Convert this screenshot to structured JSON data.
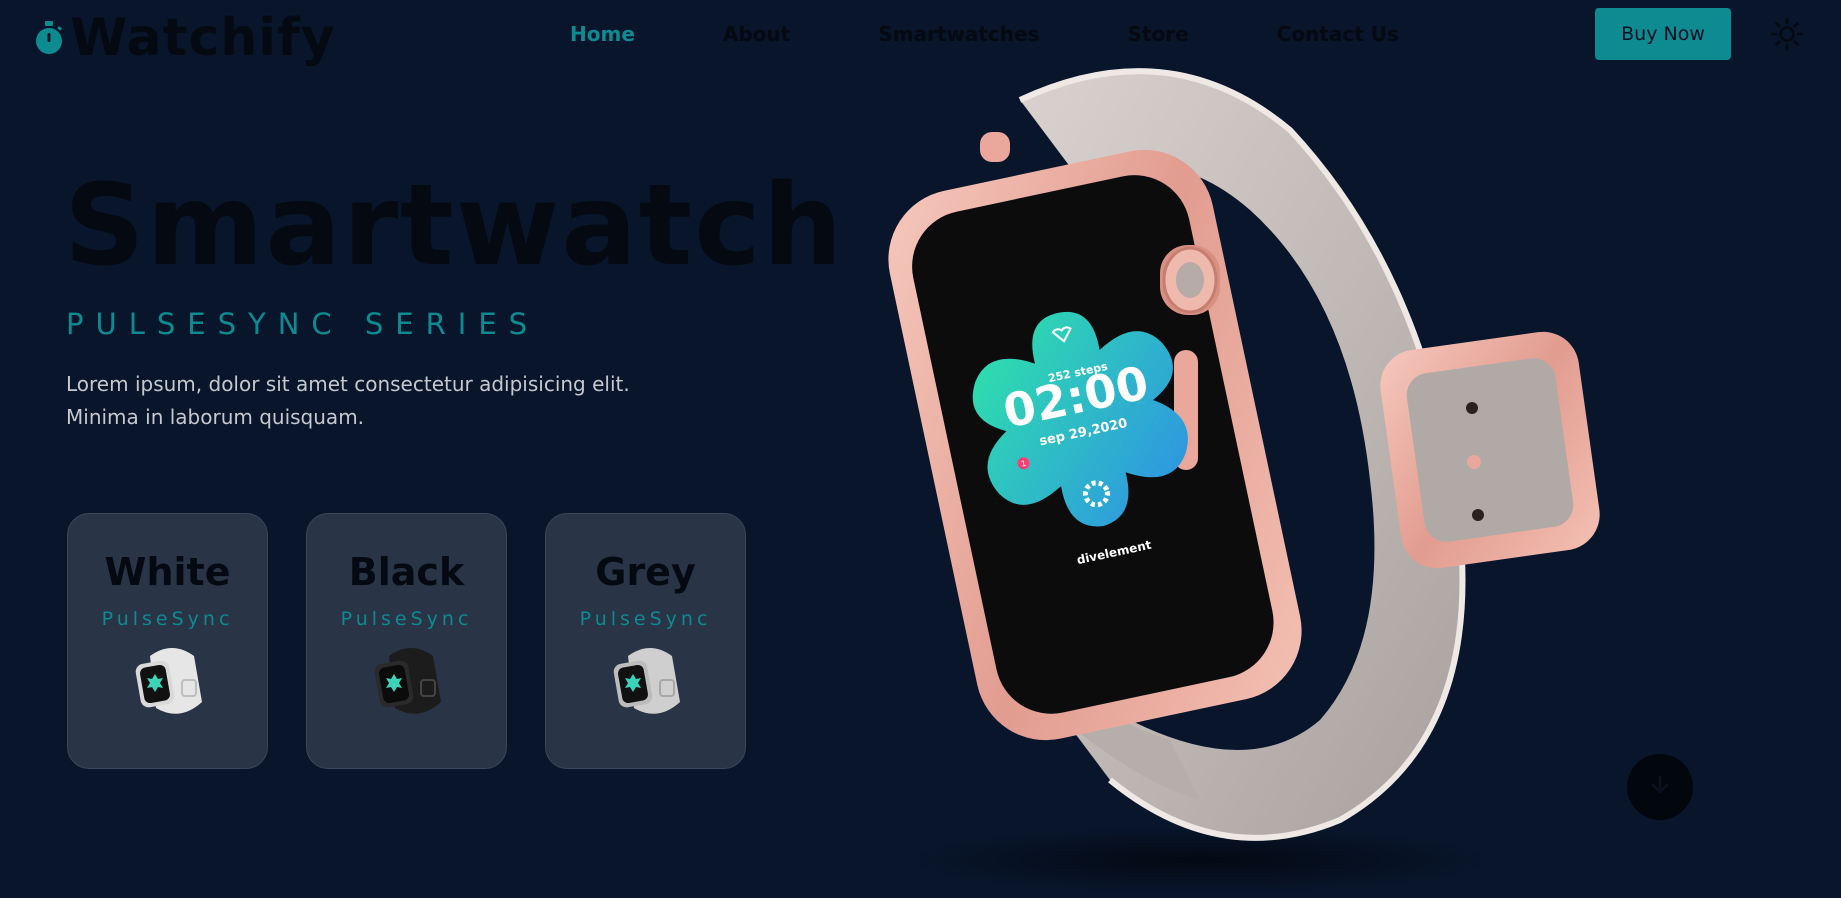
{
  "brand": {
    "name": "Watchify",
    "icon": "stopwatch-icon",
    "accent": "#0e8a91"
  },
  "nav": {
    "items": [
      {
        "label": "Home",
        "active": true
      },
      {
        "label": "About",
        "active": false
      },
      {
        "label": "Smartwatches",
        "active": false
      },
      {
        "label": "Store",
        "active": false
      },
      {
        "label": "Contact Us",
        "active": false
      }
    ],
    "cta_label": "Buy Now",
    "theme_icon": "sun-icon"
  },
  "hero": {
    "title": "Smartwatch",
    "subtitle": "PULSESYNC SERIES",
    "description": "Lorem ipsum, dolor sit amet consectetur adipisicing elit. Minima in laborum quisquam."
  },
  "variants": [
    {
      "name": "White",
      "model": "PulseSync",
      "band_color": "#e6e6e6"
    },
    {
      "name": "Black",
      "model": "PulseSync",
      "band_color": "#222222"
    },
    {
      "name": "Grey",
      "model": "PulseSync",
      "band_color": "#c9c9c9"
    }
  ],
  "watch_screen": {
    "steps": "252 steps",
    "time": "02:00",
    "date": "sep 29,2020",
    "brand": "divelement",
    "notification_count": "1"
  },
  "scroll_icon": "arrow-down-icon",
  "colors": {
    "background": "#08152b",
    "card": "#293446",
    "case": "#e8a79c",
    "band": "#b5aeab"
  }
}
